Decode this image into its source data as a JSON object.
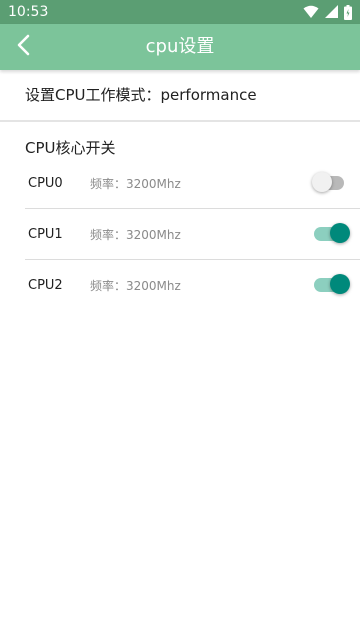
{
  "status_bar": {
    "time": "10:53",
    "icons": [
      "wifi-icon",
      "signal-icon",
      "battery-icon"
    ]
  },
  "app_bar": {
    "title": "cpu设置",
    "back_icon": "back-arrow-icon",
    "color": "#7cc49a"
  },
  "mode": {
    "label": "设置CPU工作模式：performance"
  },
  "cores_section": {
    "title": "CPU核心开关",
    "cores": [
      {
        "name": "CPU0",
        "freq": "频率：3200Mhz",
        "enabled": false
      },
      {
        "name": "CPU1",
        "freq": "频率：3200Mhz",
        "enabled": true
      },
      {
        "name": "CPU2",
        "freq": "频率：3200Mhz",
        "enabled": true
      }
    ]
  },
  "colors": {
    "accent": "#00897b",
    "accent_track": "#8ccfbf",
    "status_bar": "#5b9e73"
  }
}
